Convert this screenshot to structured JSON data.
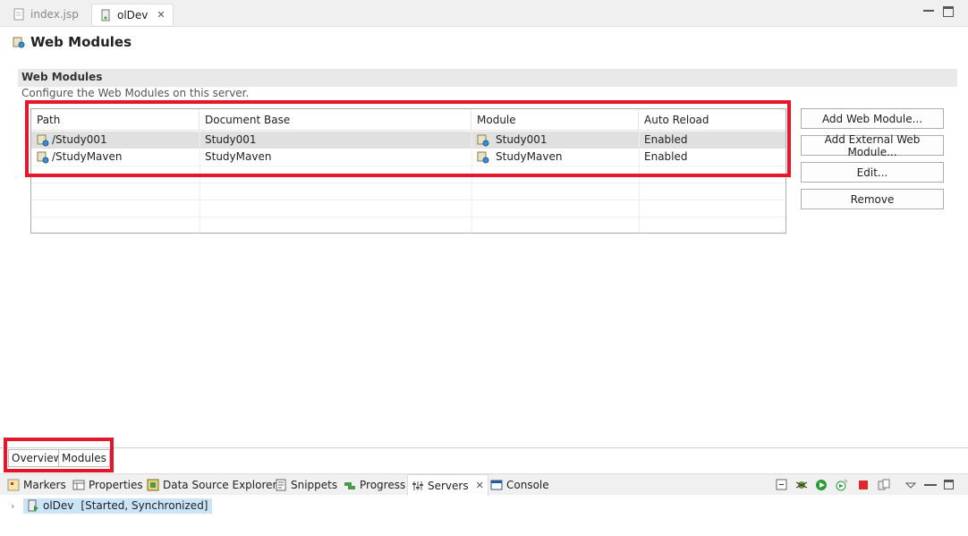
{
  "editor_tabs": [
    {
      "label": "index.jsp",
      "icon": "jsp-file-icon",
      "active": false
    },
    {
      "label": "olDev",
      "icon": "server-icon",
      "active": true
    }
  ],
  "page": {
    "title": "Web Modules"
  },
  "section": {
    "title": "Web Modules",
    "description": "Configure the Web Modules on this server."
  },
  "table": {
    "columns": [
      "Path",
      "Document Base",
      "Module",
      "Auto Reload"
    ],
    "rows": [
      {
        "path": "/Study001",
        "document_base": "Study001",
        "module": "Study001",
        "auto_reload": "Enabled",
        "selected": true
      },
      {
        "path": "/StudyMaven",
        "document_base": "StudyMaven",
        "module": "StudyMaven",
        "auto_reload": "Enabled",
        "selected": false
      }
    ]
  },
  "buttons": {
    "add_web_module": "Add Web Module...",
    "add_external_web_module": "Add External Web Module...",
    "edit": "Edit...",
    "remove": "Remove"
  },
  "page_tabs": [
    "Overview",
    "Modules"
  ],
  "views": [
    {
      "label": "Markers",
      "icon": "markers-icon"
    },
    {
      "label": "Properties",
      "icon": "properties-icon"
    },
    {
      "label": "Data Source Explorer",
      "icon": "data-source-icon"
    },
    {
      "label": "Snippets",
      "icon": "snippets-icon"
    },
    {
      "label": "Progress",
      "icon": "progress-icon"
    },
    {
      "label": "Servers",
      "icon": "servers-icon",
      "active": true
    },
    {
      "label": "Console",
      "icon": "console-icon"
    }
  ],
  "server": {
    "name": "olDev",
    "status": "[Started, Synchronized]"
  },
  "colors": {
    "highlight": "#e3162b",
    "selection": "#e0e0e0",
    "server_selection": "#cce4f7"
  }
}
